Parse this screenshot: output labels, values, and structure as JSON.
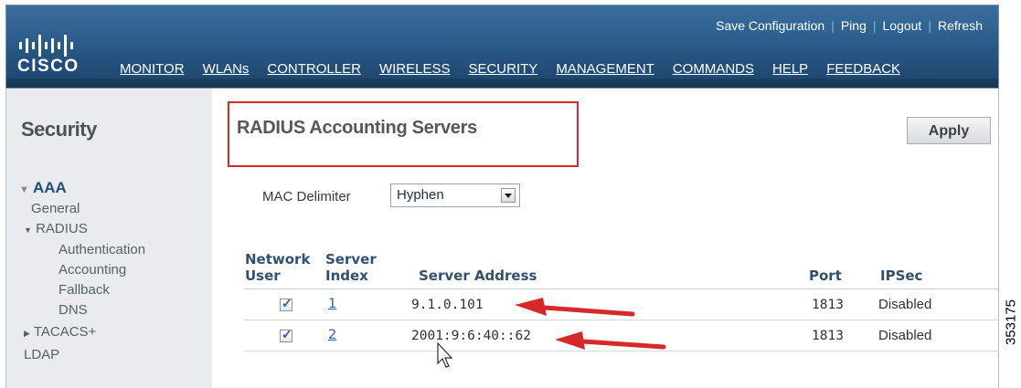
{
  "header": {
    "brand": "CISCO",
    "utility_links": [
      "Save Configuration",
      "Ping",
      "Logout",
      "Refresh"
    ],
    "nav": [
      "MONITOR",
      "WLANs",
      "CONTROLLER",
      "WIRELESS",
      "SECURITY",
      "MANAGEMENT",
      "COMMANDS",
      "HELP",
      "FEEDBACK"
    ],
    "active_nav": "SECURITY",
    "colors": {
      "bar": "#2b5d8c",
      "active_underline": "#f0a81c"
    }
  },
  "sidebar": {
    "title": "Security",
    "items": [
      {
        "label": "AAA",
        "expanded": true
      },
      {
        "label": "General"
      },
      {
        "label": "RADIUS",
        "expanded": true
      },
      {
        "label": "Authentication"
      },
      {
        "label": "Accounting"
      },
      {
        "label": "Fallback"
      },
      {
        "label": "DNS"
      },
      {
        "label": "TACACS+",
        "expanded": false
      },
      {
        "label": "LDAP"
      }
    ]
  },
  "main": {
    "title": "RADIUS Accounting Servers",
    "apply_label": "Apply",
    "mac_delimiter": {
      "label": "MAC Delimiter",
      "value": "Hyphen"
    },
    "table": {
      "headers": {
        "network_user": [
          "Network",
          "User"
        ],
        "server_index": [
          "Server",
          "Index"
        ],
        "server_address": "Server Address",
        "port": "Port",
        "ipsec": "IPSec"
      },
      "rows": [
        {
          "network_user": true,
          "index": "1",
          "address": "9.1.0.101",
          "port": "1813",
          "ipsec": "Disabled"
        },
        {
          "network_user": true,
          "index": "2",
          "address": "2001:9:6:40::62",
          "port": "1813",
          "ipsec": "Disabled"
        }
      ]
    }
  },
  "figure_id": "353175",
  "annotation_color": "#d62a2a"
}
